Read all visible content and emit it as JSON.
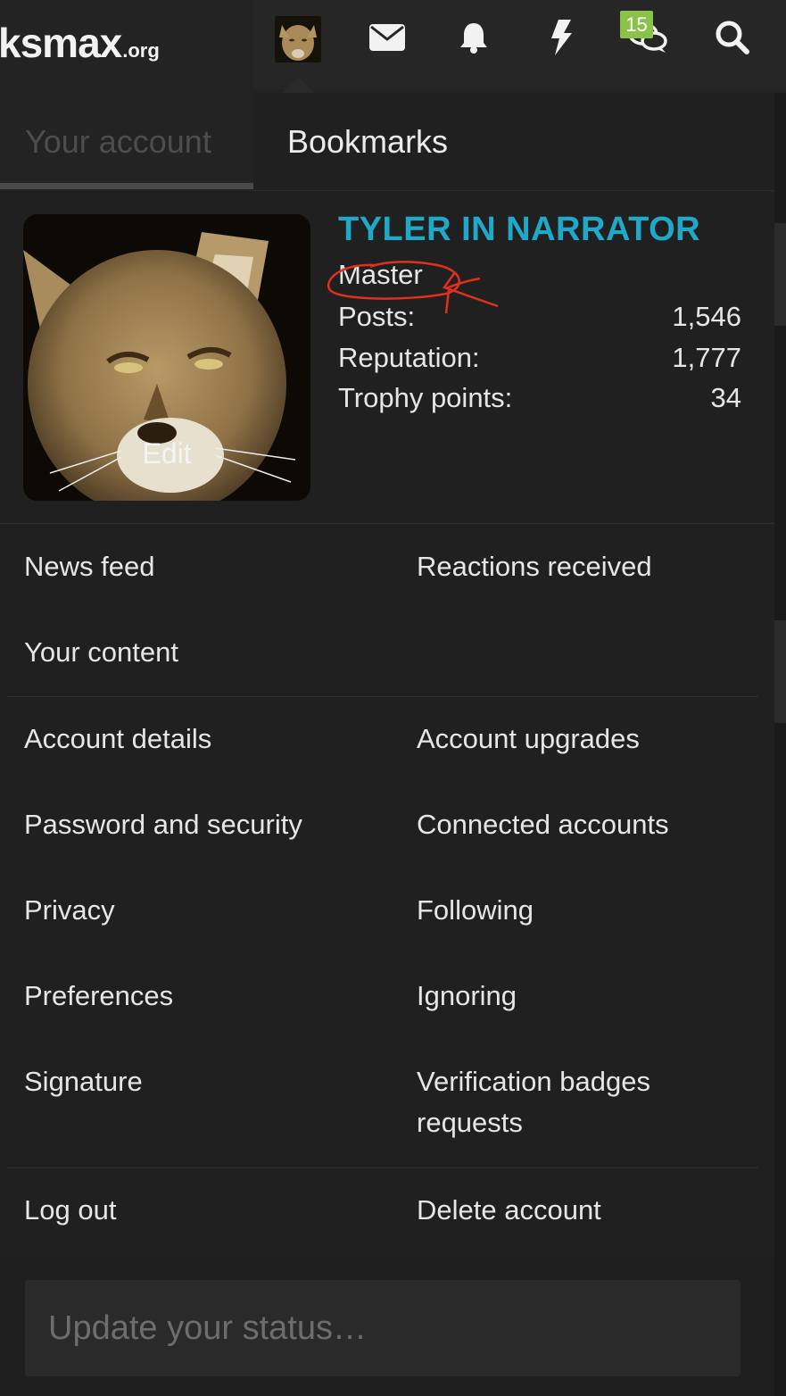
{
  "header": {
    "logo_main": "ksmax",
    "logo_tld": ".org",
    "icons": [
      "avatar",
      "envelope-icon",
      "bell-icon",
      "lightning-icon",
      "chat-icon",
      "search-icon"
    ],
    "conversations_badge": "15"
  },
  "tabs": {
    "account": "Your account",
    "bookmarks": "Bookmarks"
  },
  "profile": {
    "username": "TYLER IN NARRATOR",
    "title": "Master",
    "edit_label": "Edit",
    "stats": [
      {
        "label": "Posts:",
        "value": "1,546"
      },
      {
        "label": "Reputation:",
        "value": "1,777"
      },
      {
        "label": "Trophy points:",
        "value": "34"
      }
    ]
  },
  "menu": {
    "news_feed": "News feed",
    "reactions_received": "Reactions received",
    "your_content": "Your content",
    "account_details": "Account details",
    "account_upgrades": "Account upgrades",
    "password_security": "Password and security",
    "connected_accounts": "Connected accounts",
    "privacy": "Privacy",
    "following": "Following",
    "preferences": "Preferences",
    "ignoring": "Ignoring",
    "signature": "Signature",
    "verification_line1": "Verification badges",
    "verification_line2": "requests",
    "log_out": "Log out",
    "delete_account": "Delete account"
  },
  "status": {
    "placeholder": "Update your status…"
  },
  "colors": {
    "username": "#1fa9c9",
    "badge": "#8bc34a",
    "annotation": "#e0301e"
  }
}
